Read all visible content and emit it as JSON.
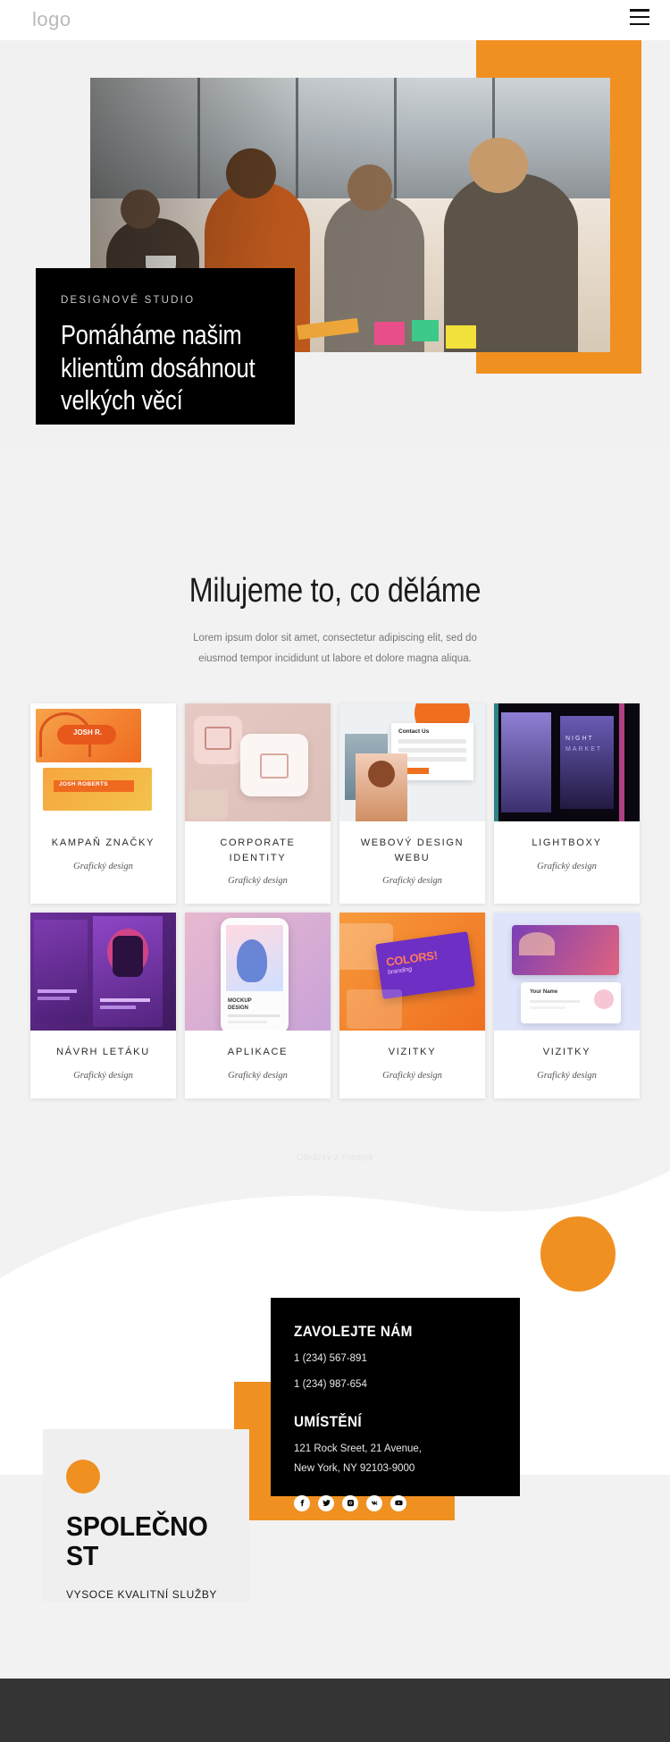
{
  "header": {
    "logo": "logo",
    "menu_icon": "hamburger-menu-icon"
  },
  "hero": {
    "kicker": "DESIGNOVÉ STUDIO",
    "title_line1": "Pomáháme našim",
    "title_line2": "klientům dosáhnout",
    "title_line3": "velkých věcí",
    "accent_color": "#ef9021"
  },
  "intro": {
    "heading": "Milujeme to, co děláme",
    "paragraph": "Lorem ipsum dolor sit amet, consectetur adipiscing elit, sed do eiusmod tempor incididunt ut labore et dolore magna aliqua."
  },
  "portfolio": {
    "items": [
      {
        "title": "KAMPAŇ ZNAČKY",
        "subtitle": "Grafický design",
        "thumb": "brand-campaign-thumb"
      },
      {
        "title": "CORPORATE IDENTITY",
        "subtitle": "Grafický design",
        "thumb": "corporate-identity-thumb"
      },
      {
        "title": "WEBOVÝ DESIGN WEBU",
        "subtitle": "Grafický design",
        "thumb": "web-design-thumb"
      },
      {
        "title": "LIGHTBOXY",
        "subtitle": "Grafický design",
        "thumb": "lightbox-thumb"
      },
      {
        "title": "NÁVRH LETÁKU",
        "subtitle": "Grafický design",
        "thumb": "flyer-design-thumb"
      },
      {
        "title": "APLIKACE",
        "subtitle": "Grafický design",
        "thumb": "app-design-thumb"
      },
      {
        "title": "VIZITKY",
        "subtitle": "Grafický design",
        "thumb": "business-cards-orange-thumb"
      },
      {
        "title": "VIZITKY",
        "subtitle": "Grafický design",
        "thumb": "business-cards-pastel-thumb"
      }
    ],
    "credit": "Obrázky z Freepik"
  },
  "contact": {
    "call_heading": "ZAVOLEJTE NÁM",
    "phone1": "1 (234) 567-891",
    "phone2": "1 (234) 987-654",
    "location_heading": "UMÍSTĚNÍ",
    "address_line1": "121 Rock Sreet, 21 Avenue,",
    "address_line2": "New York, NY 92103-9000",
    "socials": [
      {
        "name": "facebook-icon"
      },
      {
        "name": "twitter-icon"
      },
      {
        "name": "instagram-icon"
      },
      {
        "name": "vk-icon"
      },
      {
        "name": "youtube-icon"
      }
    ]
  },
  "company": {
    "heading": "SPOLEČNOST",
    "subtitle": "VYSOCE KVALITNÍ SLUŽBY"
  }
}
